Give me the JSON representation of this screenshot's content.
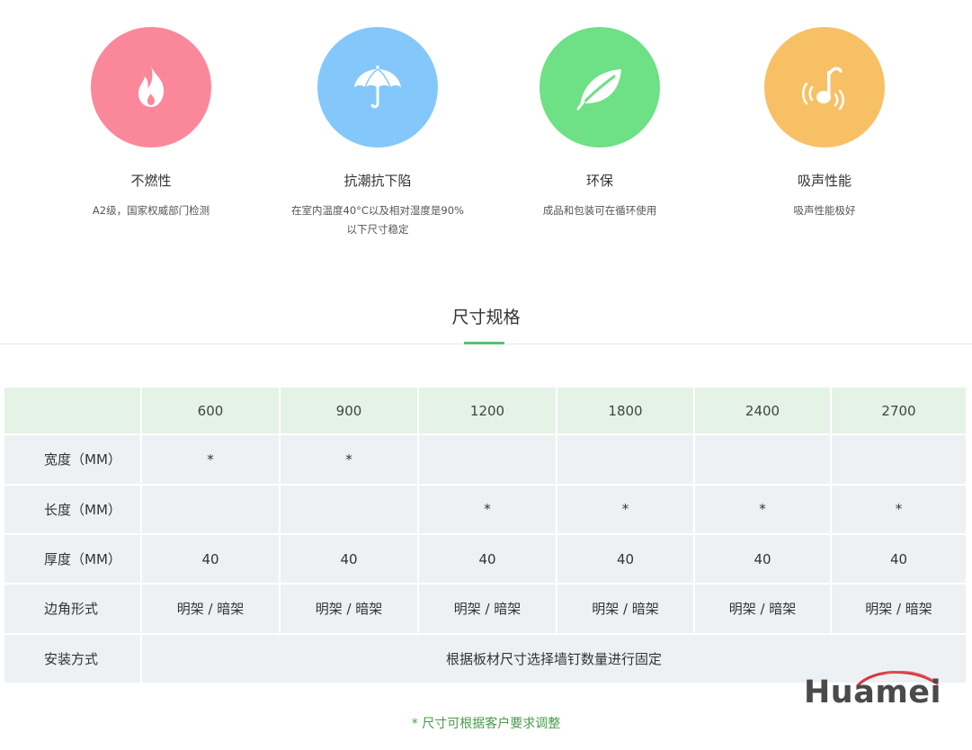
{
  "features": [
    {
      "title": "不燃性",
      "desc": "A2级，国家权威部门检测",
      "color": "#fb879a",
      "icon": "fire-icon"
    },
    {
      "title": "抗潮抗下陷",
      "desc": "在室内温度40°C以及相对湿度是90%以下尺寸稳定",
      "color": "#84c8fb",
      "icon": "umbrella-icon"
    },
    {
      "title": "环保",
      "desc": "成品和包装可在循环使用",
      "color": "#6ee086",
      "icon": "leaf-icon"
    },
    {
      "title": "吸声性能",
      "desc": "吸声性能极好",
      "color": "#f8c065",
      "icon": "music-note-icon"
    }
  ],
  "section_title": "尺寸规格",
  "table": {
    "sizes": [
      "600",
      "900",
      "1200",
      "1800",
      "2400",
      "2700"
    ],
    "rows": [
      {
        "label": "宽度（MM）",
        "cells": [
          "*",
          "*",
          "",
          "",
          "",
          ""
        ]
      },
      {
        "label": "长度（MM）",
        "cells": [
          "",
          "",
          "*",
          "*",
          "*",
          "*"
        ]
      },
      {
        "label": "厚度（MM）",
        "cells": [
          "40",
          "40",
          "40",
          "40",
          "40",
          "40"
        ]
      },
      {
        "label": "边角形式",
        "cells": [
          "明架 / 暗架",
          "明架 / 暗架",
          "明架 / 暗架",
          "明架 / 暗架",
          "明架 / 暗架",
          "明架 / 暗架"
        ]
      },
      {
        "label": "安装方式",
        "merged": "根据板材尺寸选择墙钉数量进行固定"
      }
    ]
  },
  "footnote": "*  尺寸可根据客户要求调整",
  "logo": "Huamei"
}
